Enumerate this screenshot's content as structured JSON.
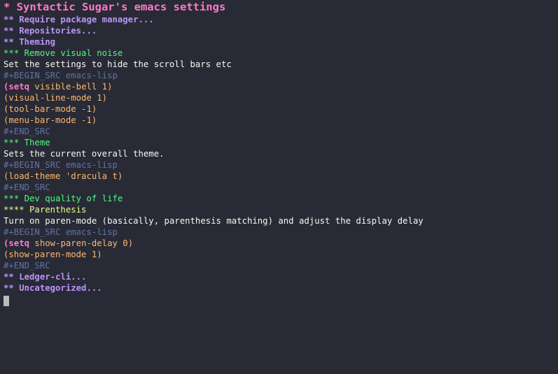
{
  "colors": {
    "background": "#282a36",
    "foreground": "#f8f8f2",
    "heading1": "#ff79c6",
    "heading2": "#bd93f9",
    "heading3": "#50fa7b",
    "heading4": "#f1fa8c",
    "meta": "#6272a4",
    "source": "#ffb86c",
    "keyword": "#ff79c6"
  },
  "lines": {
    "title": "* Syntactic Sugar's emacs settings",
    "h_require": "** Require package manager...",
    "h_repos": "** Repositories...",
    "h_theming": "** Theming",
    "h_noise": "*** Remove visual noise",
    "t_noise": "Set the settings to hide the scroll bars etc",
    "begin1": "#+BEGIN_SRC emacs-lisp",
    "src1_kw": "(setq",
    "src1_rest": " visible-bell 1)",
    "src2": "(visual-line-mode 1)",
    "src3": "(tool-bar-mode -1)",
    "src4": "(menu-bar-mode -1)",
    "end1": "#+END_SRC",
    "h_theme": "*** Theme",
    "t_theme": "Sets the current overall theme.",
    "begin2": "#+BEGIN_SRC emacs-lisp",
    "src5": "(load-theme 'dracula t)",
    "end2": "#+END_SRC",
    "h_dev": "*** Dev quality of life",
    "h_paren": "**** Parenthesis",
    "t_paren": "Turn on paren-mode (basically, parenthesis matching) and adjust the display delay",
    "begin3": "#+BEGIN_SRC emacs-lisp",
    "src6_kw": "(setq",
    "src6_rest": " show-paren-delay 0)",
    "src7": "(show-paren-mode 1)",
    "end3": "#+END_SRC",
    "h_ledger": "** Ledger-cli...",
    "h_uncat": "** Uncategorized..."
  }
}
